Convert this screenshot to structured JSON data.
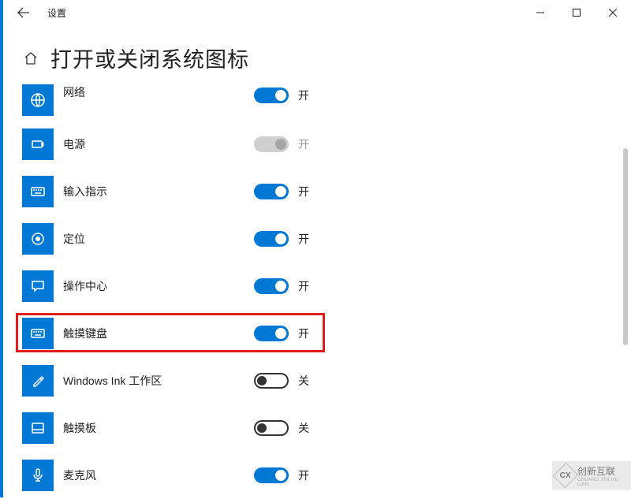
{
  "titlebar": {
    "title": "设置"
  },
  "header": {
    "title": "打开或关闭系统图标"
  },
  "items": [
    {
      "label": "网络",
      "state": "开",
      "mode": "on"
    },
    {
      "label": "电源",
      "state": "开",
      "mode": "disabled"
    },
    {
      "label": "输入指示",
      "state": "开",
      "mode": "on"
    },
    {
      "label": "定位",
      "state": "开",
      "mode": "on"
    },
    {
      "label": "操作中心",
      "state": "开",
      "mode": "on"
    },
    {
      "label": "触摸键盘",
      "state": "开",
      "mode": "on"
    },
    {
      "label": "Windows Ink 工作区",
      "state": "关",
      "mode": "off"
    },
    {
      "label": "触摸板",
      "state": "关",
      "mode": "off"
    },
    {
      "label": "麦克风",
      "state": "开",
      "mode": "on"
    }
  ],
  "watermark": {
    "brand": "创新互联",
    "sub": "CHUANG XIN HU LIAN",
    "logo": "CX"
  }
}
